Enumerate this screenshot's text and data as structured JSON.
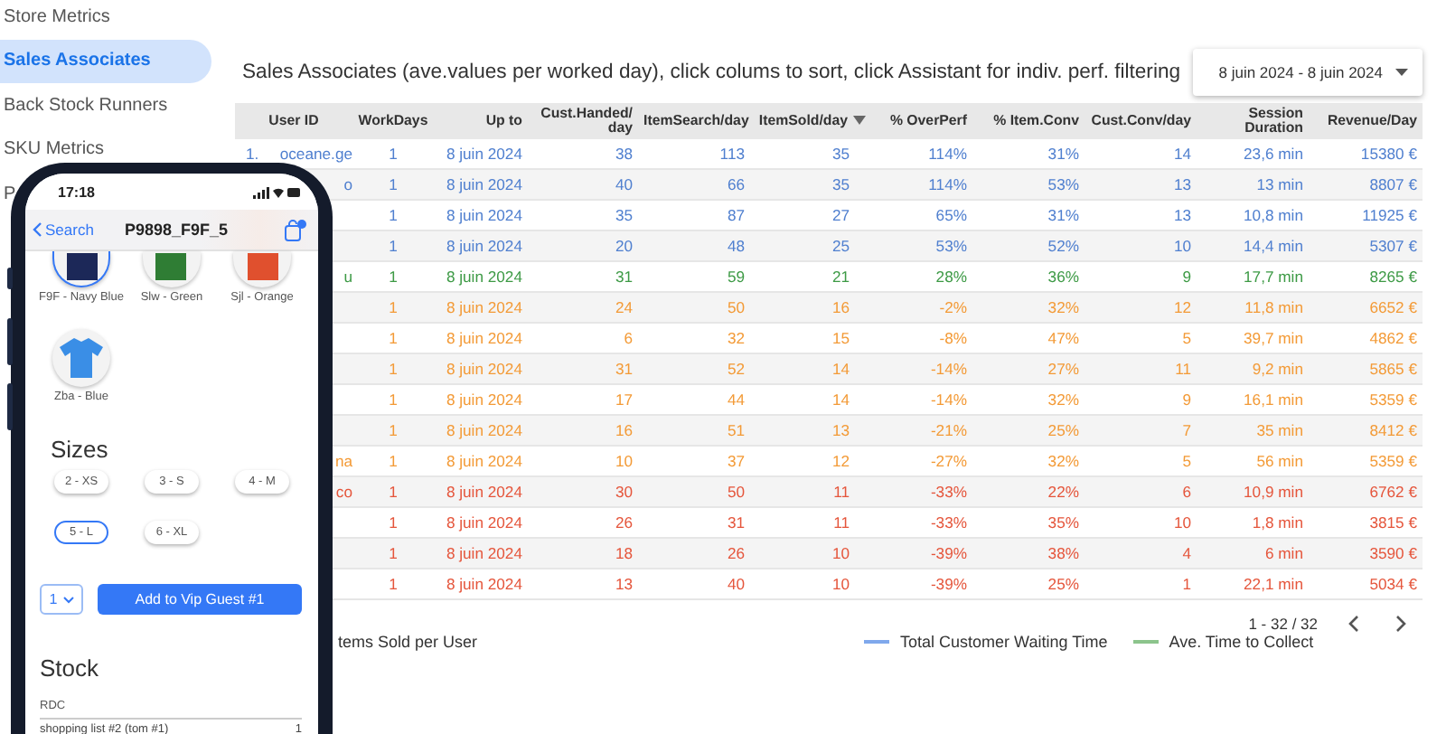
{
  "sidebar": {
    "items": [
      {
        "label": "Store Metrics",
        "selected": false
      },
      {
        "label": "Sales Associates",
        "selected": true
      },
      {
        "label": "Back Stock Runners",
        "selected": false
      },
      {
        "label": "SKU Metrics",
        "selected": false
      },
      {
        "label": "P",
        "selected": false
      }
    ]
  },
  "report": {
    "title": "Sales Associates (ave.values per worked day), click colums to sort, click Assistant for indiv. perf. filtering",
    "date_range": "8 juin 2024 - 8 juin 2024",
    "table": {
      "columns": [
        {
          "label": "User ID",
          "sorted": false
        },
        {
          "label": "WorkDays",
          "sorted": false
        },
        {
          "label": "Up to",
          "sorted": false
        },
        {
          "label": "Cust.Handed/ day",
          "sorted": false
        },
        {
          "label": "ItemSearch/day",
          "sorted": false
        },
        {
          "label": "ItemSold/day",
          "sorted": true
        },
        {
          "label": "% OverPerf",
          "sorted": false
        },
        {
          "label": "% Item.Conv",
          "sorted": false
        },
        {
          "label": "Cust.Conv/day",
          "sorted": false
        },
        {
          "label": "Session Duration",
          "sorted": false
        },
        {
          "label": "Revenue/Day",
          "sorted": false
        }
      ],
      "rows": [
        {
          "row_number": "1.",
          "color": "#4f7fcf",
          "cells": [
            "oceane.ge",
            "1",
            "8 juin 2024",
            "38",
            "113",
            "35",
            "114%",
            "31%",
            "14",
            "23,6 min",
            "15380 €"
          ]
        },
        {
          "color": "#4f7fcf",
          "cells": [
            "o",
            "1",
            "8 juin 2024",
            "40",
            "66",
            "35",
            "114%",
            "53%",
            "13",
            "13 min",
            "8807 €"
          ]
        },
        {
          "color": "#4f7fcf",
          "cells": [
            "",
            "1",
            "8 juin 2024",
            "35",
            "87",
            "27",
            "65%",
            "31%",
            "13",
            "10,8 min",
            "11925 €"
          ]
        },
        {
          "color": "#4f7fcf",
          "cells": [
            "",
            "1",
            "8 juin 2024",
            "20",
            "48",
            "25",
            "53%",
            "52%",
            "10",
            "14,4 min",
            "5307 €"
          ]
        },
        {
          "color": "#3d9a45",
          "cells": [
            "u",
            "1",
            "8 juin 2024",
            "31",
            "59",
            "21",
            "28%",
            "36%",
            "9",
            "17,7 min",
            "8265 €"
          ]
        },
        {
          "color": "#f39a36",
          "cells": [
            "",
            "1",
            "8 juin 2024",
            "24",
            "50",
            "16",
            "-2%",
            "32%",
            "12",
            "11,8 min",
            "6652 €"
          ]
        },
        {
          "color": "#f39a36",
          "cells": [
            "",
            "1",
            "8 juin 2024",
            "6",
            "32",
            "15",
            "-8%",
            "47%",
            "5",
            "39,7 min",
            "4862 €"
          ]
        },
        {
          "color": "#f39a36",
          "cells": [
            "",
            "1",
            "8 juin 2024",
            "31",
            "52",
            "14",
            "-14%",
            "27%",
            "11",
            "9,2 min",
            "5865 €"
          ]
        },
        {
          "color": "#f39a36",
          "cells": [
            "",
            "1",
            "8 juin 2024",
            "17",
            "44",
            "14",
            "-14%",
            "32%",
            "9",
            "16,1 min",
            "5359 €"
          ]
        },
        {
          "color": "#f39a36",
          "cells": [
            "",
            "1",
            "8 juin 2024",
            "16",
            "51",
            "13",
            "-21%",
            "25%",
            "7",
            "35 min",
            "8412 €"
          ]
        },
        {
          "color": "#f39a36",
          "cells": [
            "na",
            "1",
            "8 juin 2024",
            "10",
            "37",
            "12",
            "-27%",
            "32%",
            "5",
            "56 min",
            "5359 €"
          ]
        },
        {
          "color": "#e5553b",
          "cells": [
            "co",
            "1",
            "8 juin 2024",
            "30",
            "50",
            "11",
            "-33%",
            "22%",
            "6",
            "10,9 min",
            "6762 €"
          ]
        },
        {
          "color": "#e5553b",
          "cells": [
            "",
            "1",
            "8 juin 2024",
            "26",
            "31",
            "11",
            "-33%",
            "35%",
            "10",
            "1,8 min",
            "3815 €"
          ]
        },
        {
          "color": "#e5553b",
          "cells": [
            "",
            "1",
            "8 juin 2024",
            "18",
            "26",
            "10",
            "-39%",
            "38%",
            "4",
            "6 min",
            "3590 €"
          ]
        },
        {
          "color": "#e5553b",
          "cells": [
            "",
            "1",
            "8 juin 2024",
            "13",
            "40",
            "10",
            "-39%",
            "25%",
            "1",
            "22,1 min",
            "5034 €"
          ]
        }
      ]
    },
    "pagination": "1 - 32 / 32"
  },
  "chart": {
    "title": "tems Sold per User",
    "legend": [
      {
        "label": "Total Customer Waiting Time",
        "color": "#7fa8ec"
      },
      {
        "label": "Ave. Time to Collect",
        "color": "#8cc48c"
      }
    ]
  },
  "phone": {
    "time": "17:18",
    "back_label": "Search",
    "title": "P9898_F9F_5",
    "variants": [
      {
        "kind": "swatch",
        "label": "F9F - Navy Blue",
        "color": "#1c2858",
        "selected": true
      },
      {
        "kind": "swatch",
        "label": "Slw - Green",
        "color": "#2f7d34",
        "selected": false
      },
      {
        "kind": "swatch",
        "label": "Sjl - Orange",
        "color": "#e0502e",
        "selected": false
      },
      {
        "kind": "shirt",
        "label": "Zba - Blue",
        "color": "#3a8ee6",
        "selected": false
      }
    ],
    "sizes_heading": "Sizes",
    "sizes": [
      {
        "label": "2 - XS",
        "selected": false
      },
      {
        "label": "3 - S",
        "selected": false
      },
      {
        "label": "4 - M",
        "selected": false
      },
      {
        "label": "5 - L",
        "selected": true
      },
      {
        "label": "6 - XL",
        "selected": false
      }
    ],
    "quantity": "1",
    "add_button": "Add to Vip Guest #1",
    "stock_heading": "Stock",
    "stock_location": "RDC",
    "stock_rows": [
      {
        "label": "shopping list #2 (tom #1)",
        "count": "1"
      }
    ]
  }
}
